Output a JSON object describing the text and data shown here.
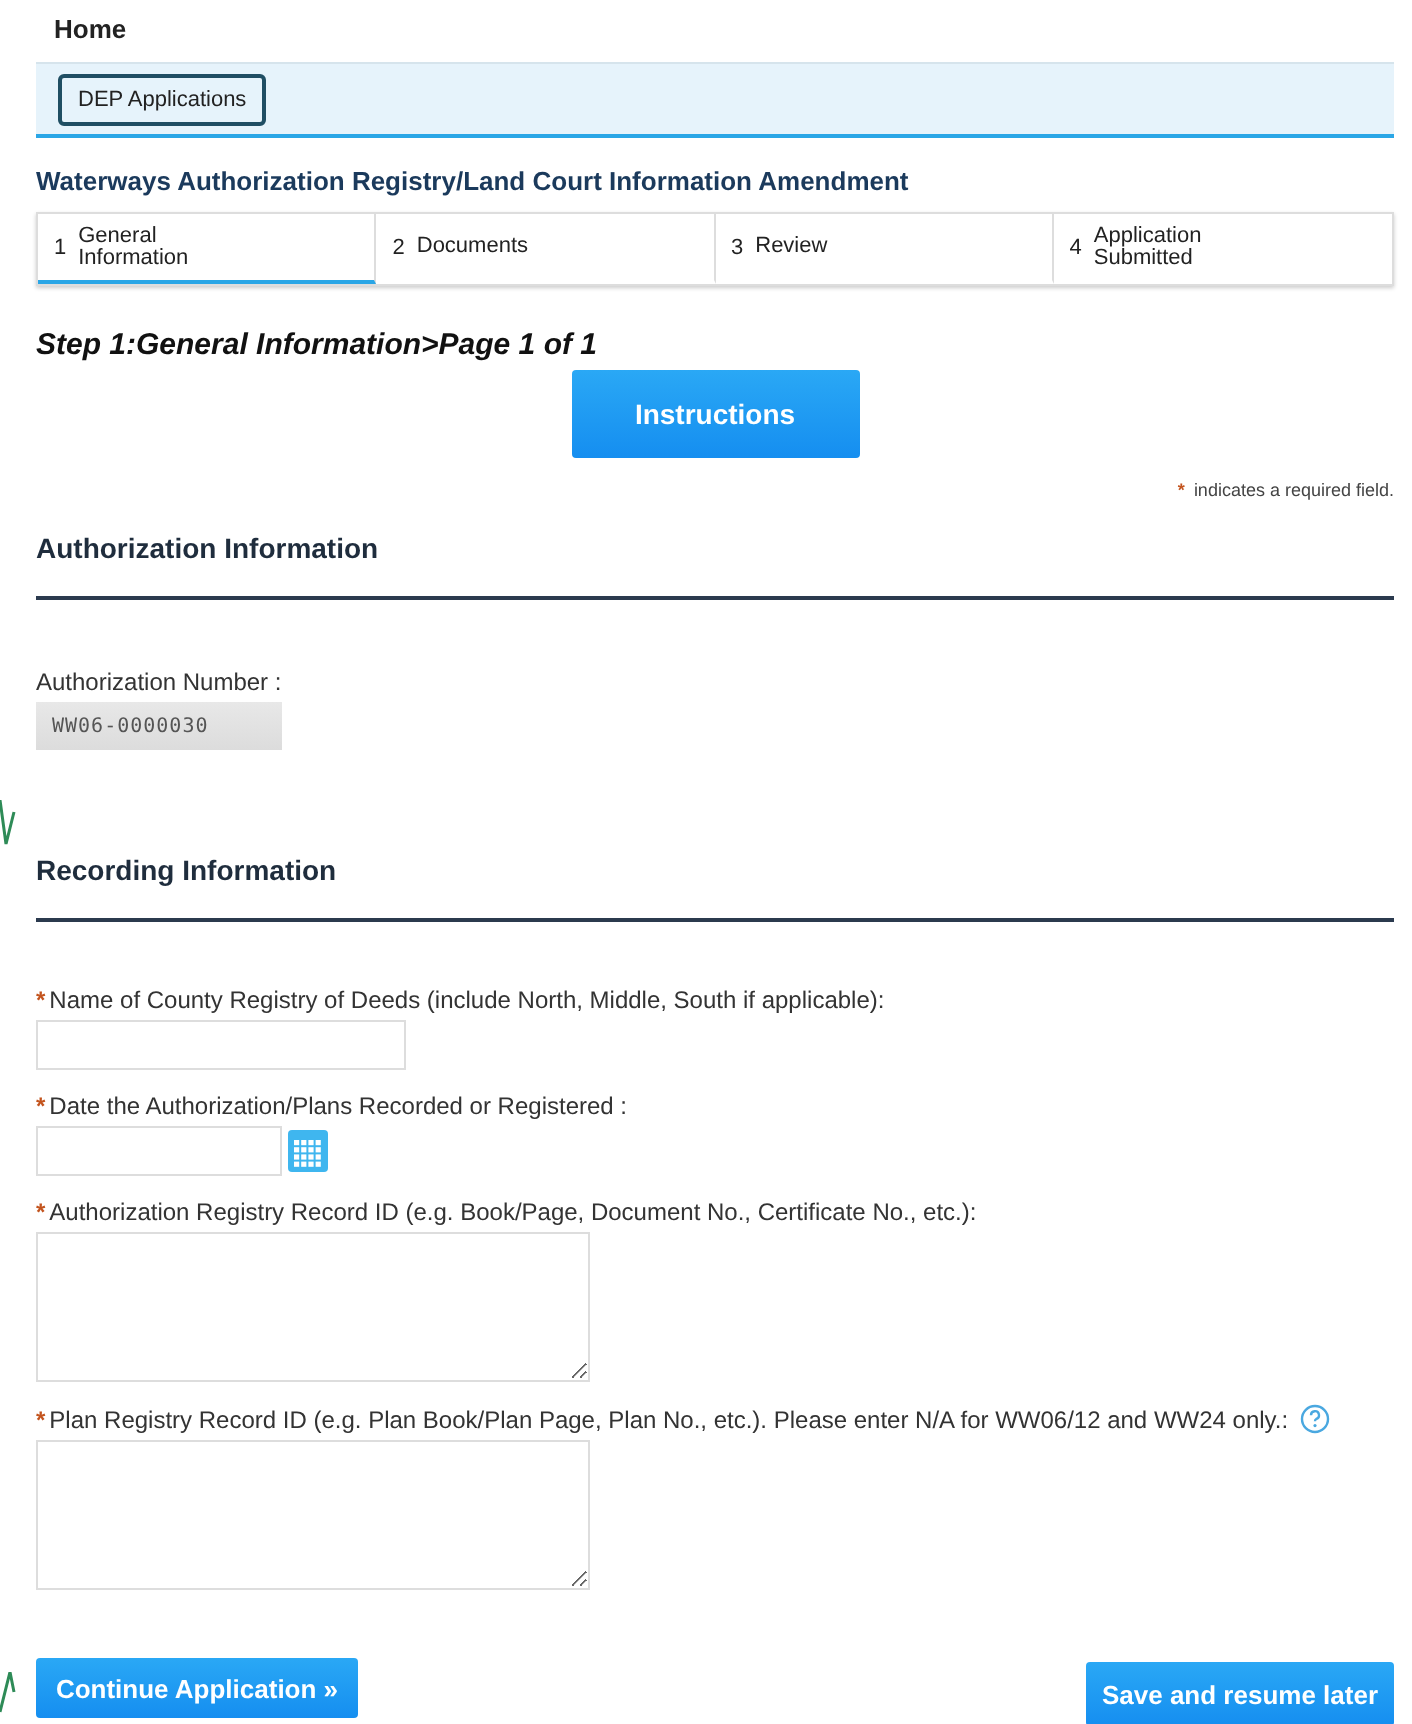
{
  "breadcrumb": "Home",
  "nav": {
    "button": "DEP Applications"
  },
  "page_title": "Waterways Authorization Registry/Land Court Information Amendment",
  "steps": [
    {
      "number": "1",
      "label": "General Information",
      "selected": true
    },
    {
      "number": "2",
      "label": "Documents",
      "selected": false
    },
    {
      "number": "3",
      "label": "Review",
      "selected": false
    },
    {
      "number": "4",
      "label": "Application Submitted",
      "selected": false
    }
  ],
  "step_heading": "Step 1:General Information>Page 1 of 1",
  "instructions_button": "Instructions",
  "required_note": {
    "mark": "*",
    "text": "indicates a required field."
  },
  "sections": [
    {
      "title": "Authorization Information",
      "fields": [
        {
          "kind": "readonly",
          "label": "Authorization Number :",
          "required": false,
          "help": false,
          "value": "WW06-0000030"
        }
      ]
    },
    {
      "title": "Recording Information",
      "fields": [
        {
          "kind": "text",
          "label": "Name of County Registry of Deeds (include North, Middle, South if applicable):",
          "required": true,
          "help": false
        },
        {
          "kind": "date",
          "label": "Date the Authorization/Plans Recorded or Registered :",
          "required": true,
          "help": false
        },
        {
          "kind": "textarea",
          "label": "Authorization Registry Record ID (e.g. Book/Page, Document No., Certificate No., etc.):",
          "required": true,
          "help": false
        },
        {
          "kind": "textarea",
          "label": "Plan Registry Record ID (e.g. Plan Book/Plan Page, Plan No., etc.). Please enter N/A for WW06/12 and WW24 only.:",
          "required": true,
          "help": true
        }
      ]
    }
  ],
  "actions": [
    "Continue Application »",
    "Save and resume later"
  ]
}
